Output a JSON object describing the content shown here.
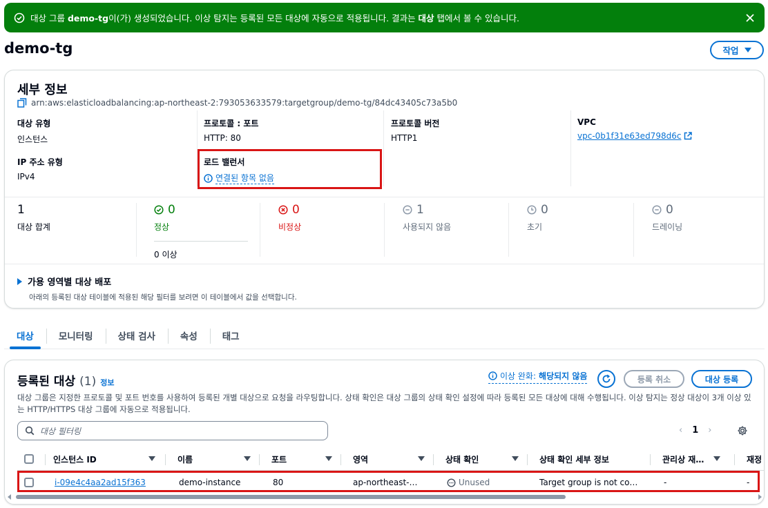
{
  "flash": {
    "pre": "대상 그룹 ",
    "name": "demo-tg",
    "mid": "이(가) 생성되었습니다. 이상 탐지는 등록된 모든 대상에 자동으로 적용됩니다. 결과는 ",
    "tab_word": "대상",
    "post": " 탭에서 볼 수 있습니다."
  },
  "page": {
    "title": "demo-tg",
    "actions_label": "작업"
  },
  "details": {
    "heading": "세부 정보",
    "arn": "arn:aws:elasticloadbalancing:ap-northeast-2:793053633579:targetgroup/demo-tg/84dc43405c73a5b0",
    "fields": {
      "target_type_label": "대상 유형",
      "target_type_value": "인스턴스",
      "protocol_port_label": "프로토콜 : 포트",
      "protocol_port_value": "HTTP: 80",
      "protocol_version_label": "프로토콜 버전",
      "protocol_version_value": "HTTP1",
      "vpc_label": "VPC",
      "vpc_value": "vpc-0b1f31e63ed798d6c",
      "ip_type_label": "IP 주소 유형",
      "ip_type_value": "IPv4",
      "lb_label": "로드 밸런서",
      "lb_value": "연결된 항목 없음"
    },
    "stats": {
      "total_value": "1",
      "total_label": "대상 합계",
      "healthy_value": "0",
      "healthy_label": "정상",
      "healthy_sub": "0 이상",
      "unhealthy_value": "0",
      "unhealthy_label": "비정상",
      "unused_value": "1",
      "unused_label": "사용되지 않음",
      "initial_value": "0",
      "initial_label": "초기",
      "draining_value": "0",
      "draining_label": "드레이닝"
    },
    "az": {
      "title": "가용 영역별 대상 배포",
      "desc": "아래의 등록된 대상 테이블에 적용된 해당 필터를 보려면 이 테이블에서 값을 선택합니다."
    }
  },
  "tabs": [
    "대상",
    "모니터링",
    "상태 검사",
    "속성",
    "태그"
  ],
  "targets": {
    "title": "등록된 대상",
    "count": "(1)",
    "info": "정보",
    "anomaly_prefix": "이상 완화: ",
    "anomaly_value": "해당되지 않음",
    "deregister_label": "등록 취소",
    "register_label": "대상 등록",
    "description": "대상 그룹은 지정한 프로토콜 및 포트 번호를 사용하여 등록된 개별 대상으로 요청을 라우팅합니다. 상태 확인은 대상 그룹의 상태 확인 설정에 따라 등록된 모든 대상에 대해 수행됩니다. 이상 탐지는 정상 대상이 3개 이상 있는 HTTP/HTTPS 대상 그룹에 자동으로 적용됩니다.",
    "filter_placeholder": "대상 필터링",
    "page": "1",
    "columns": [
      "인스턴스 ID",
      "이름",
      "포트",
      "영역",
      "상태 확인",
      "상태 확인 세부 정보",
      "관리상 재…",
      "재정"
    ],
    "rows": [
      {
        "instance_id": "i-09e4c4aa2ad15f363",
        "name": "demo-instance",
        "port": "80",
        "zone": "ap-northeast-…",
        "health": "Unused",
        "health_detail": "Target group is not co…",
        "admin": "-",
        "override": "-"
      }
    ]
  },
  "colors": {
    "success": "#037f0c",
    "link": "#0972d3",
    "error": "#d91515",
    "highlight": "#d91515"
  }
}
